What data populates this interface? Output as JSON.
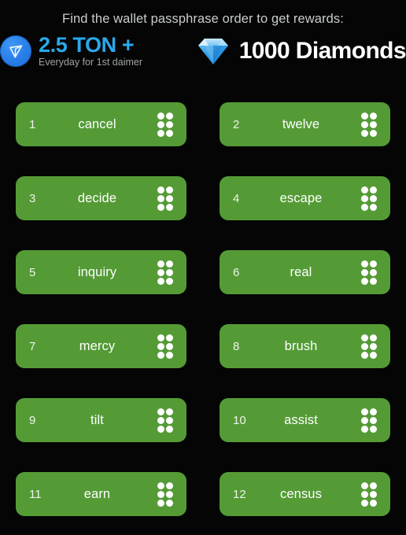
{
  "header": {
    "headline": "Find the wallet passphrase order to get rewards:",
    "ton_reward": {
      "icon": "ton-logo-icon",
      "amount": "2.5 TON +",
      "subtitle": "Everyday for 1st daimer",
      "color": "#29a9ea"
    },
    "diamond_reward": {
      "icon": "diamond-gem-icon",
      "amount": "1000 Diamonds",
      "color": "#ffffff"
    }
  },
  "theme": {
    "background": "#050505",
    "card_green": "#549b36",
    "headline_gray": "#c9ccce",
    "ton_blue": "#29a9ea",
    "white": "#ffffff"
  },
  "words": [
    {
      "index": "1",
      "label": "cancel"
    },
    {
      "index": "2",
      "label": "twelve"
    },
    {
      "index": "3",
      "label": "decide"
    },
    {
      "index": "4",
      "label": "escape"
    },
    {
      "index": "5",
      "label": "inquiry"
    },
    {
      "index": "6",
      "label": "real"
    },
    {
      "index": "7",
      "label": "mercy"
    },
    {
      "index": "8",
      "label": "brush"
    },
    {
      "index": "9",
      "label": "tilt"
    },
    {
      "index": "10",
      "label": "assist"
    },
    {
      "index": "11",
      "label": "earn"
    },
    {
      "index": "12",
      "label": "census"
    }
  ],
  "drag_handle_icon": "drag-handle-dots-icon"
}
